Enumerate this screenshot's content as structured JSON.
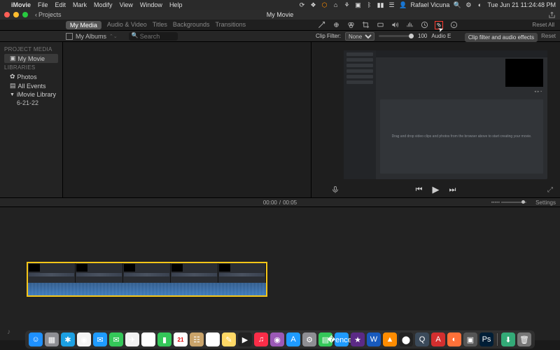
{
  "menubar": {
    "apple": "",
    "app": "iMovie",
    "menus": [
      "File",
      "Edit",
      "Mark",
      "Modify",
      "View",
      "Window",
      "Help"
    ],
    "user": "Rafael Vicuna",
    "datetime": "Tue Jun 21  11:24:48 PM"
  },
  "window": {
    "back_label": "Projects",
    "title": "My Movie"
  },
  "media_tabs": {
    "items": [
      "My Media",
      "Audio & Video",
      "Titles",
      "Backgrounds",
      "Transitions"
    ],
    "active_index": 0
  },
  "inspector": {
    "reset_all": "Reset All",
    "tooltip": "Clip filter and audio effects",
    "clip_filter_label": "Clip Filter:",
    "clip_filter_value": "None",
    "clip_vol": "100",
    "audio_eff_label": "Audio E",
    "reset": "Reset"
  },
  "albums": {
    "label": "My Albums"
  },
  "search": {
    "placeholder": "Search"
  },
  "sidebar": {
    "hdr1": "PROJECT MEDIA",
    "item_movie": "My Movie",
    "hdr2": "LIBRARIES",
    "item_photos": "Photos",
    "item_events": "All Events",
    "item_library": "iMovie Library",
    "item_date": "6-21-22"
  },
  "preview": {
    "mock_text": "Drag and drop video clips and photos from the browser above to start creating your movie."
  },
  "timeline_hdr": {
    "current": "00:00",
    "total": "00:05",
    "settings": "Settings"
  },
  "dock": {
    "items": [
      {
        "name": "finder",
        "bg": "#1e90ff",
        "g": "☺"
      },
      {
        "name": "launchpad",
        "bg": "#8e8e93",
        "g": "▦"
      },
      {
        "name": "safari",
        "bg": "#1ca0e3",
        "g": "✱"
      },
      {
        "name": "chrome",
        "bg": "#f4f4f4",
        "g": "◉"
      },
      {
        "name": "mail",
        "bg": "#1f9bff",
        "g": "✉"
      },
      {
        "name": "messages",
        "bg": "#34c759",
        "g": "✉"
      },
      {
        "name": "maps",
        "bg": "#f2f2f2",
        "g": "✈"
      },
      {
        "name": "photos",
        "bg": "#fff",
        "g": "✿"
      },
      {
        "name": "facetime",
        "bg": "#34c759",
        "g": "▮"
      },
      {
        "name": "calendar",
        "bg": "#fff",
        "g": "21"
      },
      {
        "name": "contacts",
        "bg": "#c9a36a",
        "g": "☷"
      },
      {
        "name": "reminders",
        "bg": "#fff",
        "g": "☰"
      },
      {
        "name": "notes",
        "bg": "#ffd966",
        "g": "✎"
      },
      {
        "name": "tv",
        "bg": "#222",
        "g": "▶"
      },
      {
        "name": "music",
        "bg": "#fa2d48",
        "g": "♫"
      },
      {
        "name": "podcasts",
        "bg": "#9b59b6",
        "g": "◉"
      },
      {
        "name": "appstore",
        "bg": "#1f9bff",
        "g": "A"
      },
      {
        "name": "prefs",
        "bg": "#8e8e93",
        "g": "⚙"
      },
      {
        "name": "numbers",
        "bg": "#34c759",
        "g": "▤"
      },
      {
        "name": "keynote",
        "bg": "#1f9bff",
        "g": "�ences"
      },
      {
        "name": "imovie",
        "bg": "#5b2a86",
        "g": "★"
      },
      {
        "name": "word",
        "bg": "#185abd",
        "g": "W"
      },
      {
        "name": "vlc",
        "bg": "#ff8c00",
        "g": "▲"
      },
      {
        "name": "voice",
        "bg": "#222",
        "g": "⬤"
      },
      {
        "name": "quicktime",
        "bg": "#3b4a5a",
        "g": "Q"
      },
      {
        "name": "reader",
        "bg": "#d32f2f",
        "g": "A"
      },
      {
        "name": "firefox",
        "bg": "#ff7139",
        "g": "◐"
      },
      {
        "name": "other1",
        "bg": "#555",
        "g": "▣"
      },
      {
        "name": "photoshop",
        "bg": "#001e36",
        "g": "Ps"
      }
    ],
    "right": [
      {
        "name": "downloads",
        "bg": "#3a7",
        "g": "⬇"
      },
      {
        "name": "trash",
        "bg": "#777",
        "g": "🗑"
      }
    ]
  }
}
